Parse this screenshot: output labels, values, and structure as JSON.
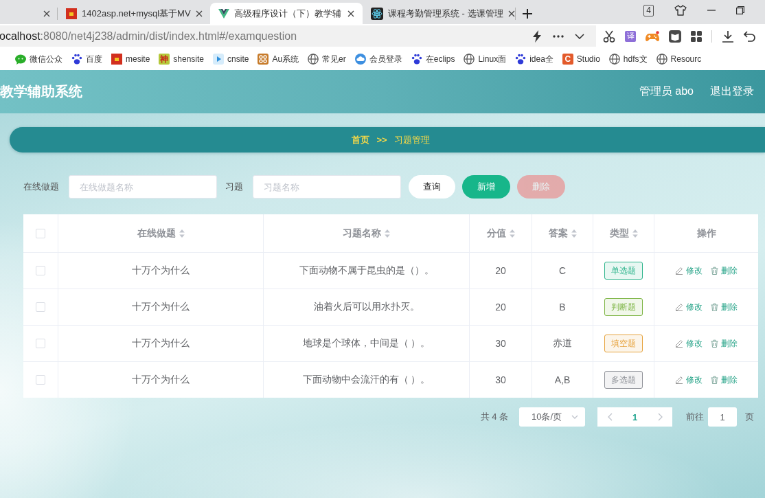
{
  "browser": {
    "tabs": [
      {
        "selected": false
      },
      {
        "title": "1402asp.net+mysql基于MV",
        "selected": false
      },
      {
        "title": "高级程序设计（下）教学辅",
        "selected": true
      },
      {
        "title": "课程考勤管理系统 - 选课管理",
        "selected": false
      }
    ],
    "tab_count": "4",
    "address": {
      "host": "ocalhost",
      "path": ":8080/net4j238/admin/dist/index.html#/examquestion"
    },
    "translate": "译",
    "bookmarks": [
      {
        "label": "微信公众"
      },
      {
        "label": "百度"
      },
      {
        "label": "mesite"
      },
      {
        "label": "shensite",
        "badge": "神"
      },
      {
        "label": "cnsite"
      },
      {
        "label": "Au系统"
      },
      {
        "label": "常见er"
      },
      {
        "label": "会员登录"
      },
      {
        "label": "在eclips"
      },
      {
        "label": "Linux面"
      },
      {
        "label": "idea全"
      },
      {
        "label": "Studio",
        "badge": "C"
      },
      {
        "label": "hdfs文"
      },
      {
        "label": "Resourc"
      }
    ]
  },
  "header": {
    "title": "教学辅助系统",
    "user": "管理员 abo",
    "logout": "退出登录"
  },
  "breadcrumb": {
    "home": "首页",
    "separator": ">>",
    "current": "习题管理"
  },
  "search": {
    "fields": [
      {
        "label": "在线做题",
        "placeholder": "在线做题名称"
      },
      {
        "label": "习题",
        "placeholder": "习题名称"
      }
    ],
    "buttons": [
      {
        "label": "查询",
        "kind": "default",
        "disabled": false
      },
      {
        "label": "新增",
        "kind": "success",
        "disabled": false
      },
      {
        "label": "删除",
        "kind": "danger",
        "disabled": true
      }
    ]
  },
  "table": {
    "select_all": {
      "checked": false
    },
    "columns": [
      {
        "label": "在线做题",
        "sortable": true
      },
      {
        "label": "习题名称",
        "sortable": true
      },
      {
        "label": "分值",
        "sortable": true
      },
      {
        "label": "答案",
        "sortable": true
      },
      {
        "label": "类型",
        "sortable": true
      },
      {
        "label": "操作",
        "sortable": false
      }
    ],
    "rows": [
      {
        "checked": false,
        "exam": "十万个为什么",
        "question": "下面动物不属于昆虫的是（）。",
        "score": "20",
        "answer": "C",
        "type": {
          "label": "单选题",
          "color": "#2db48c"
        },
        "actions": [
          {
            "label": "修改",
            "kind": "edit"
          },
          {
            "label": "删除",
            "kind": "delete"
          }
        ]
      },
      {
        "checked": false,
        "exam": "十万个为什么",
        "question": "油着火后可以用水扑灭。",
        "score": "20",
        "answer": "B",
        "type": {
          "label": "判断题",
          "color": "#7db544"
        },
        "actions": [
          {
            "label": "修改",
            "kind": "edit"
          },
          {
            "label": "删除",
            "kind": "delete"
          }
        ]
      },
      {
        "checked": false,
        "exam": "十万个为什么",
        "question": "地球是个球体，中间是（ ）。",
        "score": "30",
        "answer": "赤道",
        "type": {
          "label": "填空题",
          "color": "#e6a23c"
        },
        "actions": [
          {
            "label": "修改",
            "kind": "edit"
          },
          {
            "label": "删除",
            "kind": "delete"
          }
        ]
      },
      {
        "checked": false,
        "exam": "十万个为什么",
        "question": "下面动物中会流汗的有（ ）。",
        "score": "30",
        "answer": "A,B",
        "type": {
          "label": "多选题",
          "color": "#909399"
        },
        "actions": [
          {
            "label": "修改",
            "kind": "edit"
          },
          {
            "label": "删除",
            "kind": "delete"
          }
        ]
      }
    ]
  },
  "pagination": {
    "total": "共 4 条",
    "page_size": "10条/页",
    "pages": [
      {
        "label": "1",
        "selected": true
      }
    ],
    "goto_label": "前往",
    "goto_value": "1",
    "goto_suffix": "页"
  }
}
